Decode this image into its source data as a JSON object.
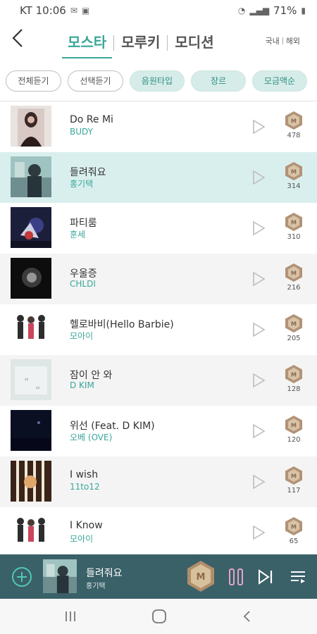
{
  "status_bar": {
    "carrier_time": "KT 10:06",
    "battery": "71%"
  },
  "header": {
    "tabs": [
      {
        "label": "모스타",
        "active": true
      },
      {
        "label": "모루키",
        "active": false
      },
      {
        "label": "모디션",
        "active": false
      }
    ],
    "region": [
      "국내",
      "해외"
    ]
  },
  "filters": {
    "chips": [
      {
        "label": "전체듣기",
        "style": "outline"
      },
      {
        "label": "선택듣기",
        "style": "outline"
      },
      {
        "label": "음원타입",
        "style": "filled"
      },
      {
        "label": "장르",
        "style": "filled"
      },
      {
        "label": "모금액순",
        "style": "filled"
      }
    ]
  },
  "songs": [
    {
      "title": "Do Re Mi",
      "artist": "BUDY",
      "count": "478",
      "state": "normal"
    },
    {
      "title": "들려줘요",
      "artist": "홍기택",
      "count": "314",
      "state": "selected"
    },
    {
      "title": "파티룸",
      "artist": "훈세",
      "count": "310",
      "state": "normal"
    },
    {
      "title": "우울증",
      "artist": "CHLDI",
      "count": "216",
      "state": "alt"
    },
    {
      "title": "헬로바비(Hello Barbie)",
      "artist": "모아이",
      "count": "205",
      "state": "normal"
    },
    {
      "title": "잠이 안 와",
      "artist": "D KIM",
      "count": "128",
      "state": "alt"
    },
    {
      "title": "위선 (Feat. D KIM)",
      "artist": "오베 (OVE)",
      "count": "120",
      "state": "normal"
    },
    {
      "title": "I wish",
      "artist": "11to12",
      "count": "117",
      "state": "alt"
    },
    {
      "title": "I Know",
      "artist": "모아이",
      "count": "65",
      "state": "normal"
    }
  ],
  "player": {
    "title": "들려줘요",
    "artist": "홍기택",
    "badge_text": "M"
  },
  "colors": {
    "accent": "#3aa69a",
    "player_bg": "#3a6068",
    "selected_row": "#d9efee",
    "pause": "#e4a3c6"
  }
}
